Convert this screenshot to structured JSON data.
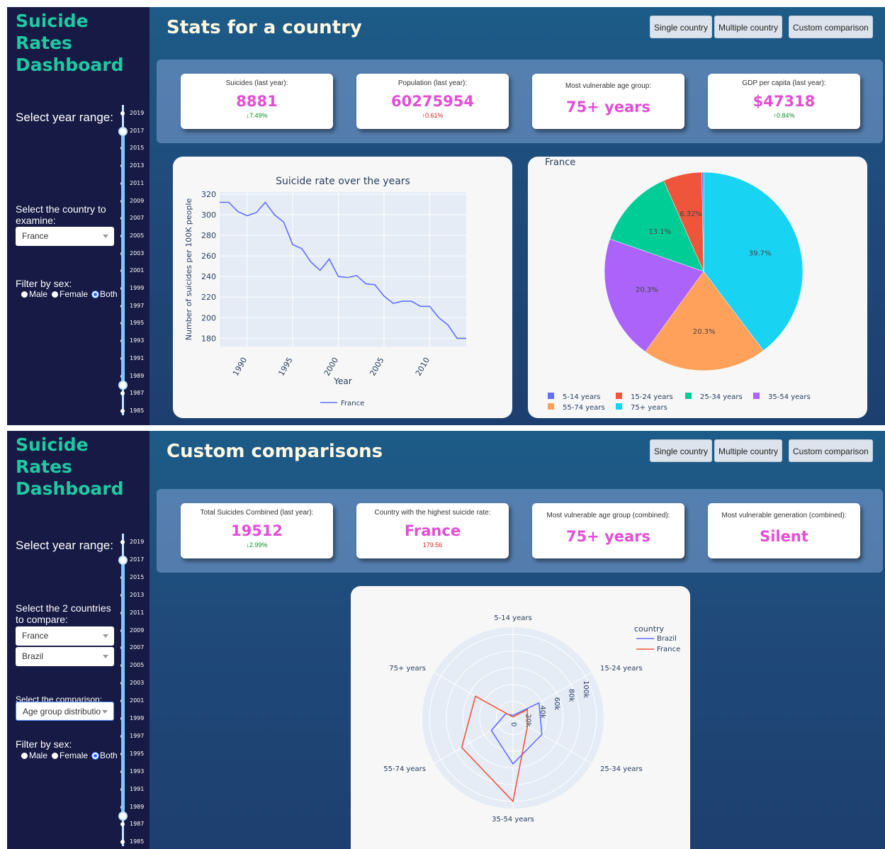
{
  "app_title": "Suicide Rates Dashboard",
  "nav": {
    "single": "Single country",
    "multiple": "Multiple country",
    "custom": "Custom comparison"
  },
  "year_ticks": [
    "2019",
    "2017",
    "2015",
    "2013",
    "2011",
    "2009",
    "2007",
    "2005",
    "2003",
    "2001",
    "1999",
    "1997",
    "1995",
    "1993",
    "1991",
    "1989",
    "1987",
    "1985"
  ],
  "screen1": {
    "title": "Stats for a country",
    "year_label": "Select year range:",
    "country_label": "Select the country to examine:",
    "country_value": "France",
    "sex_label": "Filter by sex:",
    "sex_options": [
      "Male",
      "Female",
      "Both"
    ],
    "sex_selected": "Both",
    "cards": [
      {
        "title": "Suicides (last year):",
        "value": "8881",
        "delta": "↓7.49%",
        "dir": "down"
      },
      {
        "title": "Population (last year):",
        "value": "60275954",
        "delta": "↑0.61%",
        "dir": "up"
      },
      {
        "title": "Most vulnerable age group:",
        "value": "75+ years",
        "delta": "",
        "dir": ""
      },
      {
        "title": "GDP per capita (last year):",
        "value": "$47318",
        "delta": "↑0.84%",
        "dir": "down"
      }
    ],
    "line_chart": {
      "type": "line",
      "title": "Suicide rate over the years",
      "xlabel": "Year",
      "ylabel": "Number of suicides per 100K people",
      "x_ticks": [
        "1990",
        "1995",
        "2000",
        "2005",
        "2010"
      ],
      "y_ticks": [
        "180",
        "200",
        "220",
        "240",
        "260",
        "280",
        "300",
        "320"
      ],
      "ylim": [
        172,
        322
      ],
      "xlim": [
        1987,
        2014
      ],
      "legend": "France",
      "color": "#636efa",
      "series": [
        {
          "name": "France",
          "x": [
            1987,
            1988,
            1989,
            1990,
            1991,
            1992,
            1993,
            1994,
            1995,
            1996,
            1997,
            1998,
            1999,
            2000,
            2001,
            2002,
            2003,
            2004,
            2005,
            2006,
            2007,
            2008,
            2009,
            2010,
            2011,
            2012,
            2013,
            2014
          ],
          "y": [
            312,
            312,
            303,
            299,
            302,
            312,
            300,
            293,
            271,
            267,
            254,
            246,
            257,
            240,
            239,
            241,
            233,
            232,
            221,
            214,
            216,
            216,
            211,
            211,
            200,
            193,
            180,
            180
          ]
        }
      ]
    },
    "pie_chart": {
      "type": "pie",
      "title": "France",
      "slices": [
        {
          "label": "75+ years",
          "value": 39.7,
          "text": "39.7%",
          "color": "#19d3f3"
        },
        {
          "label": "55-74 years",
          "value": 20.3,
          "text": "20.3%",
          "color": "#ffa15a"
        },
        {
          "label": "35-54 years",
          "value": 20.3,
          "text": "20.3%",
          "color": "#ab63fa"
        },
        {
          "label": "25-34 years",
          "value": 13.1,
          "text": "13.1%",
          "color": "#00cc96"
        },
        {
          "label": "15-24 years",
          "value": 6.32,
          "text": "6.32%",
          "color": "#ef553b"
        },
        {
          "label": "5-14 years",
          "value": 0.28,
          "text": "",
          "color": "#636efa"
        }
      ],
      "legend": [
        "5-14 years",
        "15-24 years",
        "25-34 years",
        "35-54 years",
        "55-74 years",
        "75+ years"
      ],
      "legend_colors": [
        "#636efa",
        "#ef553b",
        "#00cc96",
        "#ab63fa",
        "#ffa15a",
        "#19d3f3"
      ]
    }
  },
  "screen2": {
    "title": "Custom comparisons",
    "year_label": "Select year range:",
    "countries_label": "Select the 2 countries to compare:",
    "country1": "France",
    "country2": "Brazil",
    "comparison_label": "Select the comparison:",
    "comparison_value": "Age group distributio",
    "sex_label": "Filter by sex:",
    "sex_options": [
      "Male",
      "Female",
      "Both"
    ],
    "sex_selected": "Both",
    "cards": [
      {
        "title": "Total Suicides Combined (last year):",
        "value": "19512",
        "delta": "↓2.99%",
        "dir": "down"
      },
      {
        "title": "Country with the highest suicide rate:",
        "value": "France",
        "delta": "179.56",
        "dir": "up"
      },
      {
        "title": "Most vulnerable age group (combined):",
        "value": "75+ years",
        "delta": "",
        "dir": ""
      },
      {
        "title": "Most vulnerable generation (combined):",
        "value": "Silent",
        "delta": "",
        "dir": ""
      }
    ],
    "radar_chart": {
      "type": "line",
      "axes": [
        "5-14 years",
        "15-24 years",
        "25-34 years",
        "35-54 years",
        "55-74 years",
        "75+ years"
      ],
      "radial_ticks": [
        "0",
        "20k",
        "40k",
        "60k",
        "80k",
        "100k"
      ],
      "rmax": 100000,
      "legend_title": "country",
      "series": [
        {
          "name": "Brazil",
          "color": "#636efa",
          "values": [
            3000,
            36000,
            40000,
            55000,
            30000,
            10000
          ]
        },
        {
          "name": "France",
          "color": "#ef553b",
          "values": [
            1000,
            20000,
            20000,
            100000,
            71000,
            52000
          ]
        }
      ]
    }
  }
}
